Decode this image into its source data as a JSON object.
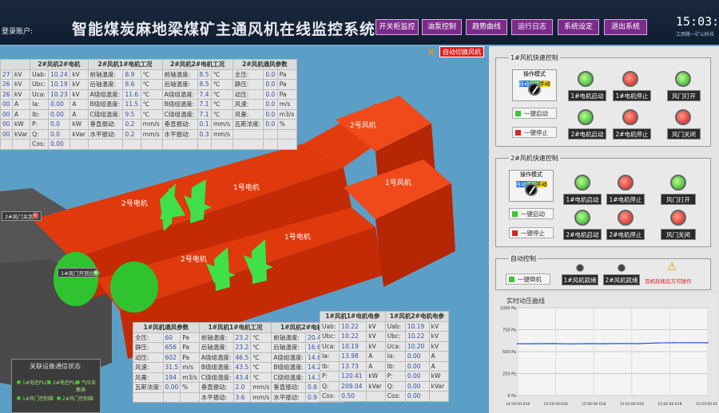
{
  "header": {
    "login_label": "登录账户:",
    "title": "智能煤炭麻地梁煤矿主通风机在线监控系统",
    "nav": [
      "开关柜监控",
      "油泵控制",
      "趋势曲线",
      "运行日志",
      "系统设定",
      "退出系统"
    ],
    "time": "15:03:4",
    "company": "江西腾一矿山科技"
  },
  "auto_switch_label": "自动切换风机",
  "fan1_table": {
    "headers": [
      "2#风机2#电机",
      "2#风机1#电机工况",
      "2#风机2#电机工况",
      "2#风机通风参数"
    ],
    "rows": [
      [
        "27",
        "kV",
        "Uab:",
        "10.24",
        "kV",
        "前轴温度:",
        "8.9",
        "℃",
        "前轴温度:",
        "8.5",
        "℃",
        "全压:",
        "0.0",
        "Pa"
      ],
      [
        "26",
        "kV",
        "Ubc:",
        "10.19",
        "kV",
        "后轴温度:",
        "8.6",
        "℃",
        "后轴温度:",
        "8.5",
        "℃",
        "静压:",
        "0.0",
        "Pa"
      ],
      [
        "26",
        "kV",
        "Uca:",
        "10.23",
        "kV",
        "A绕组温度:",
        "11.6",
        "℃",
        "A绕组温度:",
        "7.4",
        "℃",
        "动压:",
        "0.0",
        "Pa"
      ],
      [
        "00",
        "A",
        "Ia:",
        "0.00",
        "A",
        "B绕组温度:",
        "11.5",
        "℃",
        "B绕组温度:",
        "7.1",
        "℃",
        "风速:",
        "0.0",
        "m/s"
      ],
      [
        "00",
        "A",
        "Ib:",
        "0.00",
        "A",
        "C绕组温度:",
        "9.5",
        "℃",
        "C绕组温度:",
        "7.1",
        "℃",
        "风量:",
        "0.0",
        "m3/s"
      ],
      [
        "00",
        "kW",
        "P:",
        "0.0",
        "kW",
        "垂直振动:",
        "0.2",
        "mm/s",
        "垂直振动:",
        "0.1",
        "mm/s",
        "瓦斯浓度:",
        "0.0",
        "%"
      ],
      [
        "00",
        "kVar",
        "Q:",
        "0.0",
        "kVar",
        "水平振动:",
        "0.2",
        "mm/s",
        "水平振动:",
        "0.3",
        "mm/s",
        "",
        "",
        ""
      ],
      [
        "",
        "",
        "Cos:",
        "0.00",
        "",
        "",
        "",
        "",
        "",
        "",
        "",
        "",
        "",
        ""
      ]
    ]
  },
  "fan2_bottom": {
    "headers": [
      "1#风机通风参数",
      "1#风机1#电机工况",
      "1#风机2#电机温度"
    ],
    "rows": [
      [
        "全压:",
        "60",
        "Pa",
        "前轴温度:",
        "23.2",
        "℃",
        "前轴温度:",
        "20.4",
        "℃"
      ],
      [
        "静压:",
        "656",
        "Pa",
        "后轴温度:",
        "23.2",
        "℃",
        "后轴温度:",
        "16.6",
        "℃"
      ],
      [
        "动压:",
        "602",
        "Pa",
        "A绕组温度:",
        "46.5",
        "℃",
        "A绕组温度:",
        "14.6",
        "℃"
      ],
      [
        "风速:",
        "31.5",
        "m/s",
        "B绕组温度:",
        "43.5",
        "℃",
        "B绕组温度:",
        "14.2",
        "℃"
      ],
      [
        "风量:",
        "194",
        "m3/s",
        "C绕组温度:",
        "43.4",
        "℃",
        "C绕组温度:",
        "14.3",
        "℃"
      ],
      [
        "瓦斯浓度:",
        "0.00",
        "%",
        "垂直振动:",
        "2.0",
        "mm/s",
        "垂直振动:",
        "0.6",
        "mm/s"
      ],
      [
        "",
        "",
        "",
        "水平振动:",
        "3.6",
        "mm/s",
        "水平振动:",
        "0.9",
        "mm/s"
      ]
    ]
  },
  "elec_bottom": {
    "headers": [
      "1#风机1#电机电参",
      "1#风机2#电机电参"
    ],
    "rows": [
      [
        "Uab:",
        "10.22",
        "kV",
        "Uab:",
        "10.19",
        "kV"
      ],
      [
        "Ubc:",
        "10.22",
        "kV",
        "Ubc:",
        "10.22",
        "kV"
      ],
      [
        "Uca:",
        "10.19",
        "kV",
        "Uca:",
        "10.20",
        "kV"
      ],
      [
        "Ia:",
        "13.98",
        "A",
        "Ia:",
        "0.00",
        "A"
      ],
      [
        "Ib:",
        "13.73",
        "A",
        "Ib:",
        "0.00",
        "A"
      ],
      [
        "P:",
        "120.41",
        "kW",
        "P:",
        "0.00",
        "kW"
      ],
      [
        "Q:",
        "209.04",
        "kVar",
        "Q:",
        "0.00",
        "kVar"
      ],
      [
        "Cos:",
        "0.50",
        "",
        "Cos:",
        "0.00",
        ""
      ]
    ]
  },
  "scene": {
    "fan2_label": "2号风机",
    "fan1_label": "1号风机",
    "motor2_top": "2号电机",
    "motor1_top": "1号电机",
    "motor2_bottom": "2号电机",
    "motor1_bottom": "1号电机",
    "door2": "2#风门关到位",
    "door1": "1#风门开到位"
  },
  "status_box": {
    "title": "关联设备通信状态",
    "items": [
      "1#电控PLC",
      "2#电控PLC",
      "气压采集箱",
      "1#风门控制箱",
      "2#风门控制箱"
    ]
  },
  "panel1": {
    "title": "1#风机快速控制",
    "mode_label": "操作模式",
    "mode_auto": "自动",
    "mode_local": "远控",
    "mode_manual": "手动",
    "btn_start": "一键启动",
    "btn_stop": "一键停止",
    "leds": [
      "1#电机启动",
      "1#电机停止",
      "风门打开",
      "2#电机启动",
      "2#电机停止",
      "风门关闭"
    ]
  },
  "panel2": {
    "title": "2#风机快速控制",
    "mode_label": "操作模式",
    "mode_auto": "自动",
    "mode_local": "远控",
    "mode_manual": "手动",
    "btn_start": "一键启动",
    "btn_stop": "一键停止",
    "leds": [
      "1#电机启动",
      "1#电机停止",
      "风门打开",
      "2#电机启动",
      "2#电机停止",
      "风门关闭"
    ]
  },
  "auto_panel": {
    "title": "自动控制",
    "btn": "一键倒机",
    "ready1": "1#风机就绪",
    "ready2": "2#风机就绪",
    "warning": "双机就绪后方可操作"
  },
  "trend": {
    "title": "实时动压曲线",
    "y_ticks": [
      "1000 Pa",
      "750 Pa",
      "500 Pa",
      "250 Pa",
      "0 Pa"
    ],
    "x_ticks": [
      "14:58:00.618",
      "14:59:00.618",
      "15:00:00.618",
      "15:01:00.618",
      "15:02:00.618",
      "15:03:00.618"
    ]
  },
  "chart_data": {
    "type": "line",
    "title": "实时动压曲线",
    "x": [
      "14:58:00",
      "14:58:30",
      "14:59:00",
      "14:59:30",
      "15:00:00",
      "15:00:30",
      "15:01:00",
      "15:01:30",
      "15:02:00",
      "15:02:30",
      "15:03:00",
      "15:03:30"
    ],
    "series": [
      {
        "values": [
          590,
          590,
          592,
          588,
          591,
          590,
          593,
          591,
          598,
          602,
          602,
          601
        ]
      }
    ],
    "ylim": [
      0,
      1000
    ],
    "grid": true
  },
  "colors": {
    "fan_body": "#e23c0e",
    "accent_nav": "#7b2b8a",
    "led_green": "#2fbf2f",
    "led_red": "#d21a1a"
  }
}
